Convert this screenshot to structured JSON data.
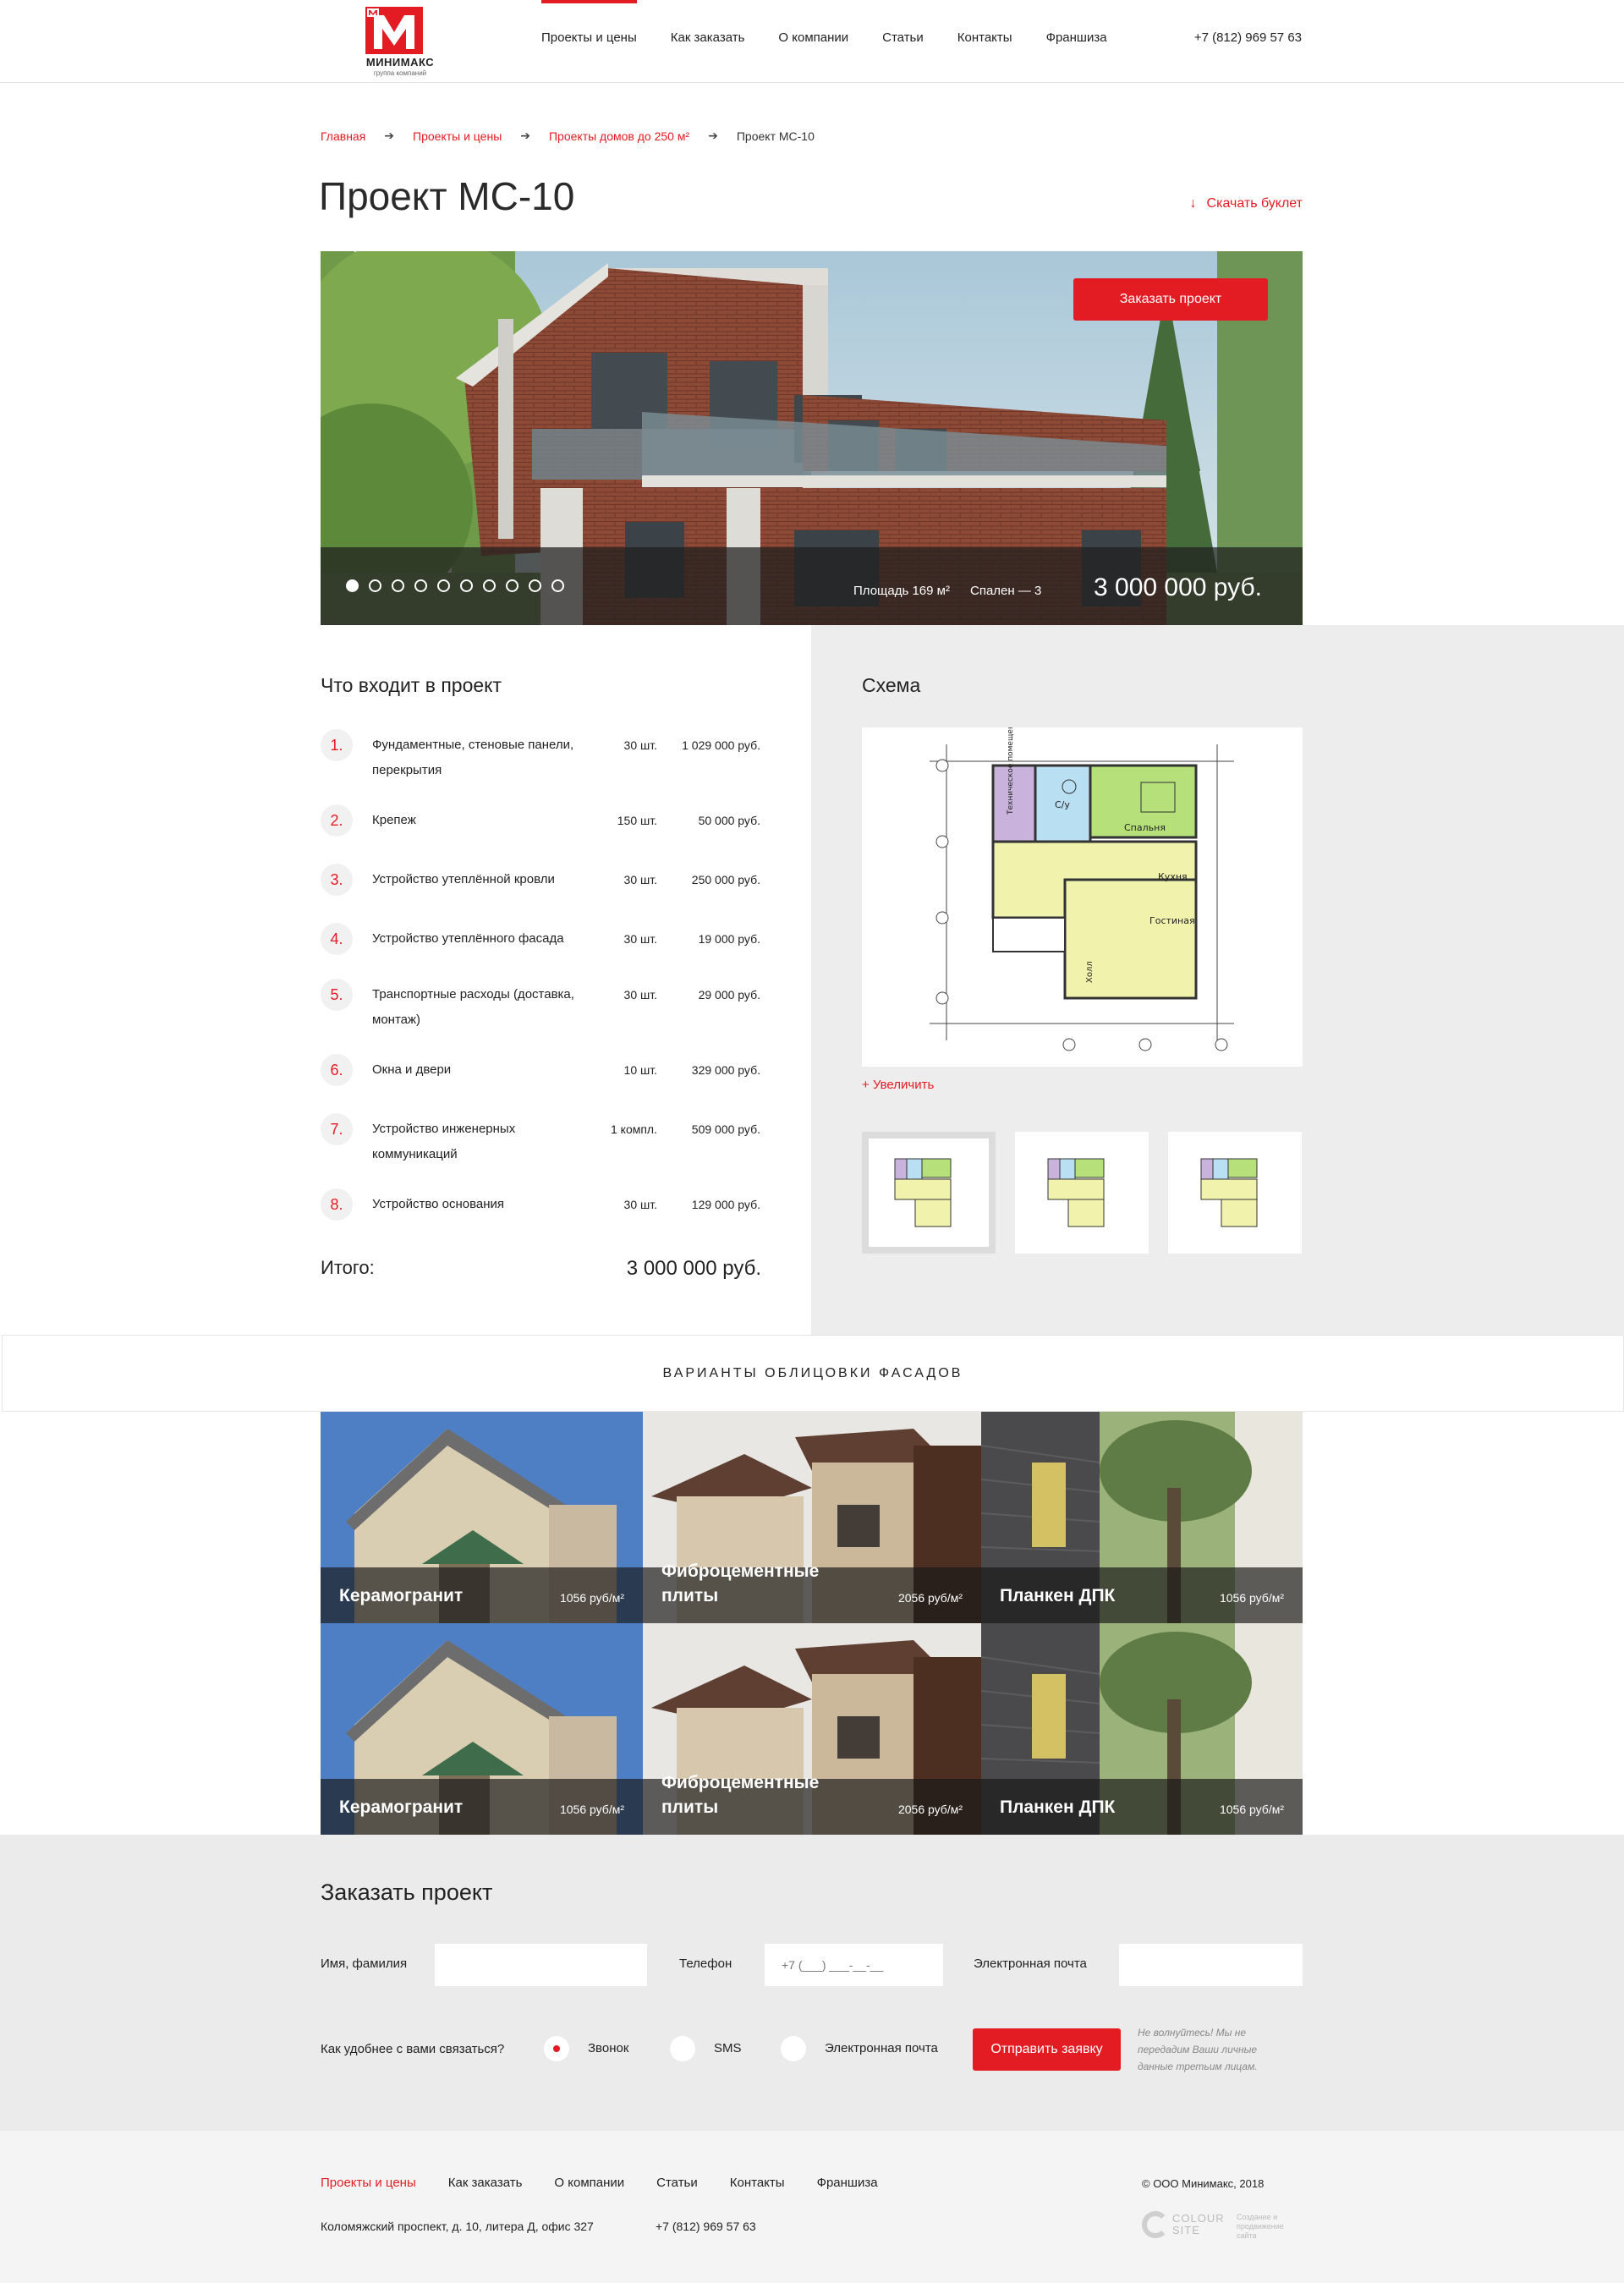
{
  "header": {
    "logo_text": "МИНИМАКС",
    "logo_sub": "группа компаний",
    "nav": [
      {
        "label": "Проекты и цены",
        "active": true
      },
      {
        "label": "Как заказать",
        "active": false
      },
      {
        "label": "О компании",
        "active": false
      },
      {
        "label": "Статьи",
        "active": false
      },
      {
        "label": "Контакты",
        "active": false
      },
      {
        "label": "Франшиза",
        "active": false
      }
    ],
    "phone": "+7 (812) 969 57 63"
  },
  "breadcrumb": [
    "Главная",
    "Проекты и цены",
    "Проекты домов до 250 м²",
    "Проект МС-10"
  ],
  "title": "Проект МС-10",
  "download_label": "Скачать буклет",
  "hero": {
    "order_button": "Заказать проект",
    "slides_total": 10,
    "slide_active": 1,
    "area": "Площадь 169 м²",
    "bedrooms": "Спален — 3",
    "price": "3 000 000 руб."
  },
  "includes": {
    "title": "Что входит в проект",
    "items": [
      {
        "n": "1.",
        "name": "Фундаментные, стеновые панели, перекрытия",
        "qty": "30 шт.",
        "price": "1 029 000 руб."
      },
      {
        "n": "2.",
        "name": "Крепеж",
        "qty": "150 шт.",
        "price": "50 000 руб."
      },
      {
        "n": "3.",
        "name": "Устройство утеплённой кровли",
        "qty": "30 шт.",
        "price": "250 000 руб."
      },
      {
        "n": "4.",
        "name": "Устройство утеплённого фасада",
        "qty": "30 шт.",
        "price": "19 000 руб."
      },
      {
        "n": "5.",
        "name": "Транспортные расходы (доставка, монтаж)",
        "qty": "30 шт.",
        "price": "29 000 руб."
      },
      {
        "n": "6.",
        "name": "Окна и двери",
        "qty": "10 шт.",
        "price": "329 000 руб."
      },
      {
        "n": "7.",
        "name": "Устройство инженерных коммуникаций",
        "qty": "1 компл.",
        "price": "509 000 руб."
      },
      {
        "n": "8.",
        "name": "Устройство основания",
        "qty": "30 шт.",
        "price": "129 000 руб."
      }
    ],
    "total_label": "Итого:",
    "total_value": "3 000 000 руб."
  },
  "scheme": {
    "title": "Схема",
    "zoom_label": "Увеличить",
    "rooms": [
      "Техническое помещение",
      "С/у",
      "Спальня",
      "Кухня",
      "Гостиная",
      "Холл"
    ],
    "thumbs_total": 3,
    "thumb_active": 1
  },
  "facades": {
    "title": "ВАРИАНТЫ ОБЛИЦОВКИ ФАСАДОВ",
    "items": [
      {
        "name": "Керамогранит",
        "price": "1056 руб/м²"
      },
      {
        "name": "Фиброцементные плиты",
        "price": "2056 руб/м²"
      },
      {
        "name": "Планкен ДПК",
        "price": "1056 руб/м²"
      },
      {
        "name": "Керамогранит",
        "price": "1056 руб/м²"
      },
      {
        "name": "Фиброцементные плиты",
        "price": "2056 руб/м²"
      },
      {
        "name": "Планкен ДПК",
        "price": "1056 руб/м²"
      }
    ]
  },
  "order_form": {
    "title": "Заказать проект",
    "name_label": "Имя, фамилия",
    "phone_label": "Телефон",
    "phone_placeholder": "+7 (___) ___-__-__",
    "email_label": "Электронная почта",
    "contact_question": "Как удобнее с вами связаться?",
    "options": [
      {
        "label": "Звонок",
        "selected": true
      },
      {
        "label": "SMS",
        "selected": false
      },
      {
        "label": "Электронная почта",
        "selected": false
      }
    ],
    "submit": "Отправить заявку",
    "note": "Не волнуйтесь! Мы не передадим Ваши личные данные третьим лицам."
  },
  "footer": {
    "nav": [
      {
        "label": "Проекты и цены",
        "active": true
      },
      {
        "label": "Как заказать",
        "active": false
      },
      {
        "label": "О компании",
        "active": false
      },
      {
        "label": "Статьи",
        "active": false
      },
      {
        "label": "Контакты",
        "active": false
      },
      {
        "label": "Франшиза",
        "active": false
      }
    ],
    "copyright": "© ООО Минимакс, 2018",
    "address": "Коломяжский проспект, д. 10, литера Д, офис 327",
    "phone": "+7 (812) 969 57 63",
    "dev_name_1": "COLOUR",
    "dev_name_2": "SITE",
    "dev_desc": "Создание и продвижение сайта"
  },
  "colors": {
    "accent": "#e31b23",
    "panel_gray": "#ededed",
    "form_gray": "#ebebeb"
  }
}
